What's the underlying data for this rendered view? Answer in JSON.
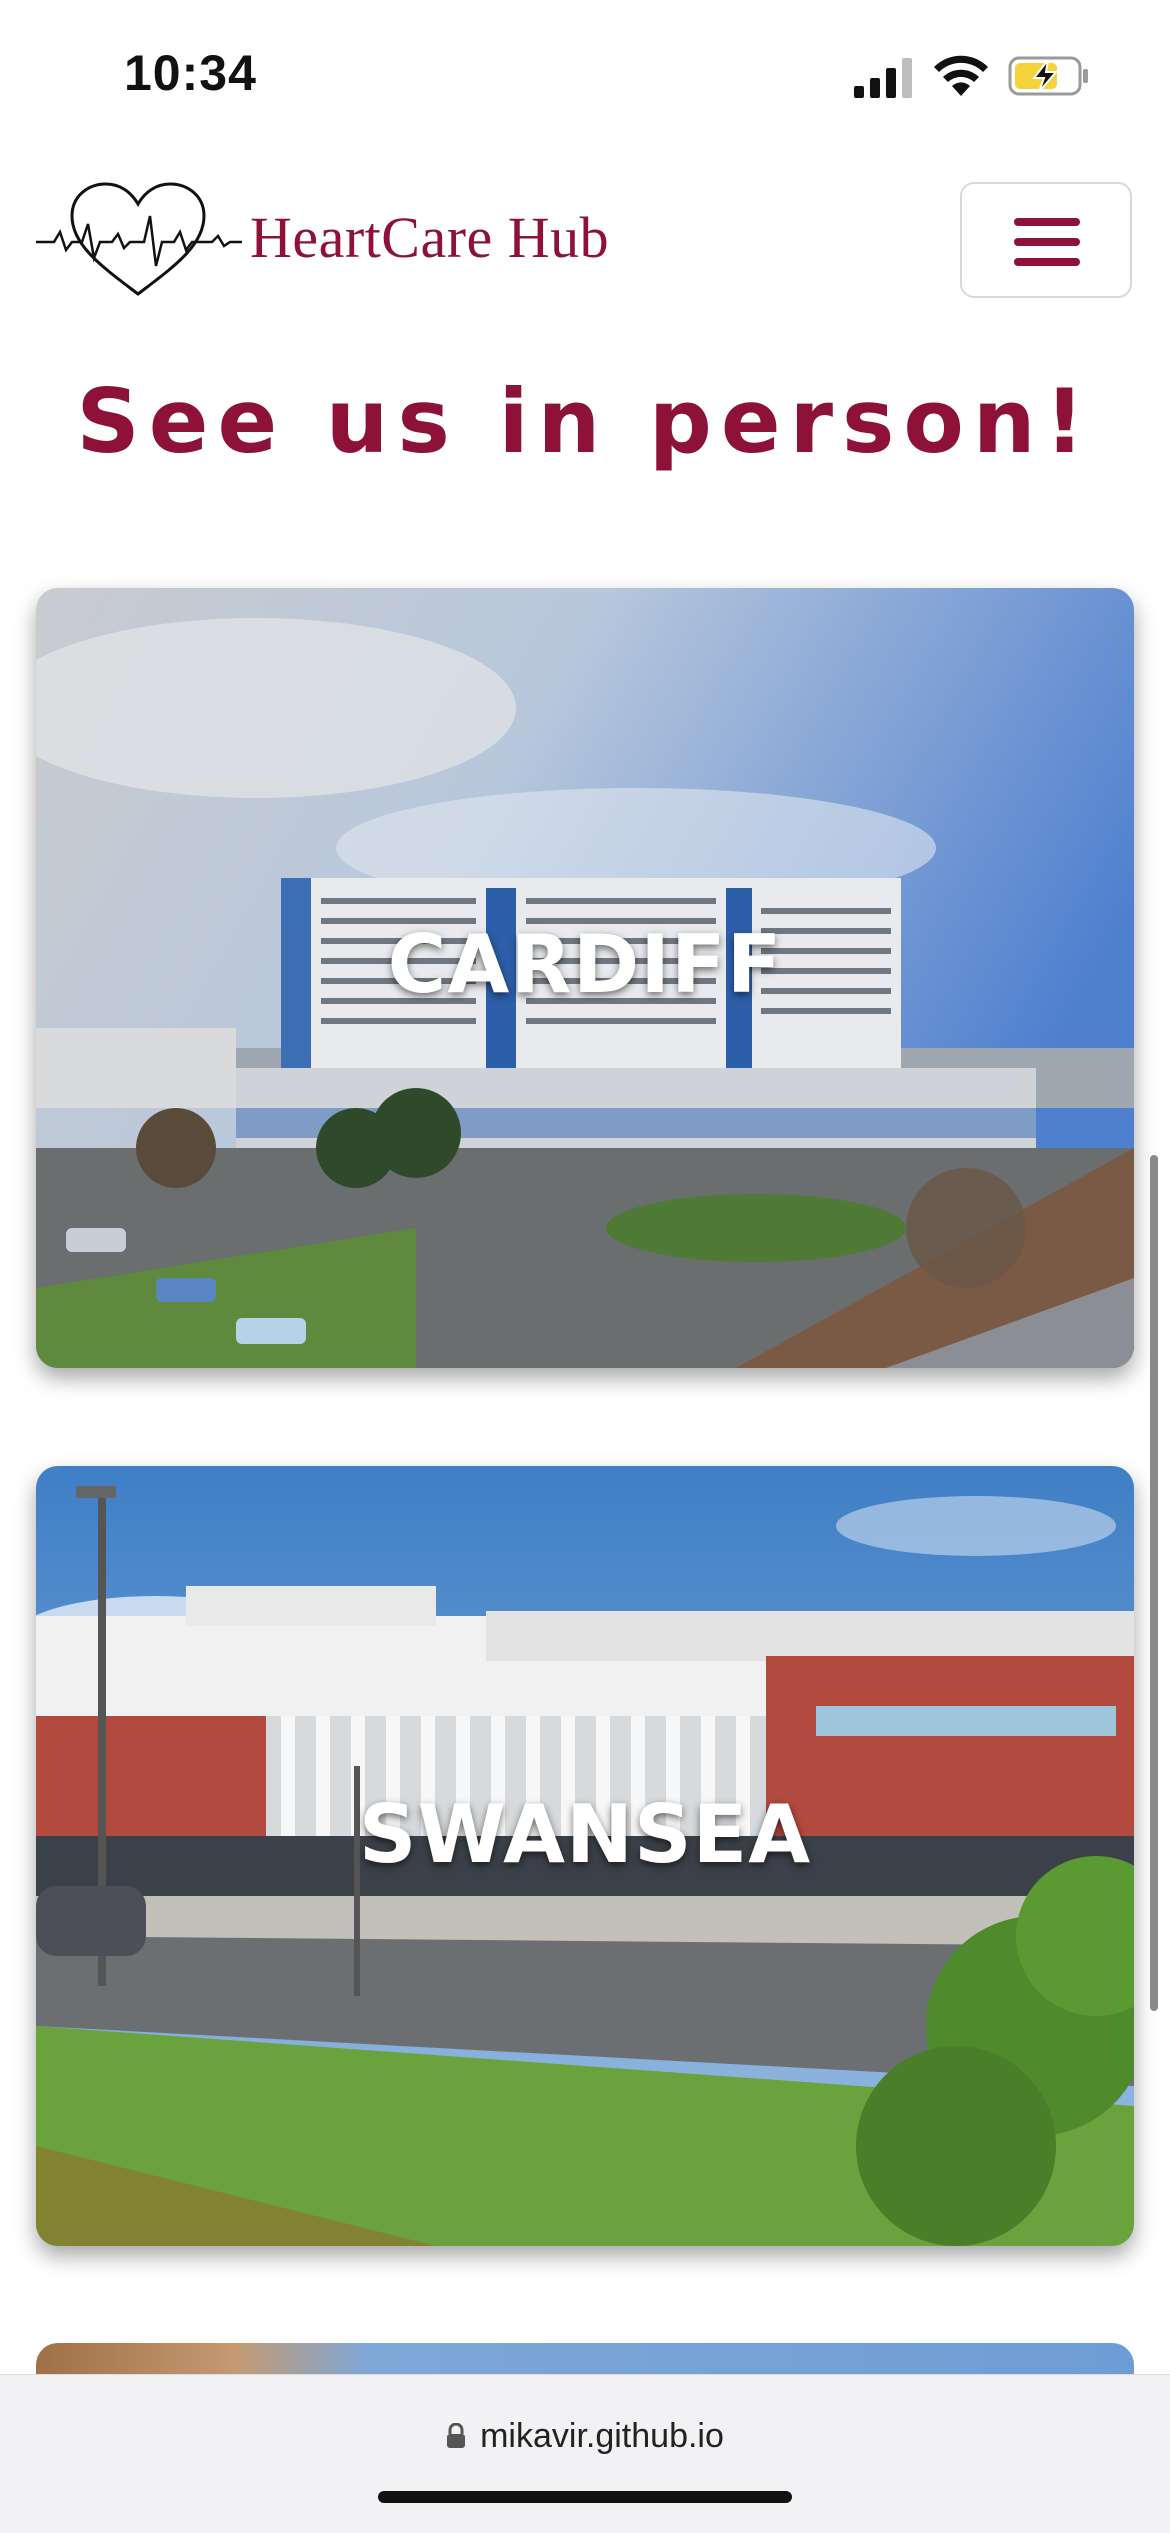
{
  "status_bar": {
    "time": "10:34"
  },
  "header": {
    "brand_name": "HeartCare Hub",
    "menu_icon": "hamburger-menu-icon",
    "logo_icon": "heart-ecg-icon"
  },
  "main": {
    "title": "See us in person!",
    "locations": [
      {
        "label": "CARDIFF"
      },
      {
        "label": "SWANSEA"
      }
    ]
  },
  "browser": {
    "url": "mikavir.github.io",
    "lock_icon": "lock-icon"
  },
  "colors": {
    "brand": "#8e1238",
    "menu_border": "#d8d8d8"
  }
}
